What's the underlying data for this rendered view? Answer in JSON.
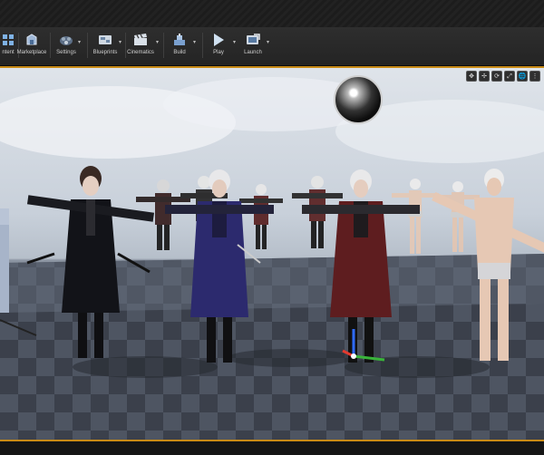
{
  "toolbar": {
    "buttons": [
      {
        "id": "content",
        "label": "ntent"
      },
      {
        "id": "marketplace",
        "label": "Marketplace"
      },
      {
        "id": "settings",
        "label": "Settings"
      },
      {
        "id": "blueprints",
        "label": "Blueprints"
      },
      {
        "id": "cinematics",
        "label": "Cinematics"
      },
      {
        "id": "build",
        "label": "Build"
      },
      {
        "id": "play",
        "label": "Play"
      },
      {
        "id": "launch",
        "label": "Launch"
      }
    ]
  },
  "viewport": {
    "tools": [
      {
        "id": "transform",
        "glyph": "✥"
      },
      {
        "id": "translate",
        "glyph": "✢"
      },
      {
        "id": "rotate",
        "glyph": "⟳"
      },
      {
        "id": "scale",
        "glyph": "⤢"
      },
      {
        "id": "world",
        "glyph": "🌐"
      },
      {
        "id": "more",
        "glyph": "⋮"
      }
    ]
  },
  "colors": {
    "accent": "#c88a16",
    "toolbar_bg": "#2a2a2a",
    "floor_dark": "#3a3f4a",
    "floor_light": "#565d6b"
  },
  "icons": [
    "content-icon",
    "marketplace-icon",
    "settings-icon",
    "blueprints-icon",
    "cinematics-icon",
    "build-icon",
    "play-icon",
    "launch-icon"
  ]
}
